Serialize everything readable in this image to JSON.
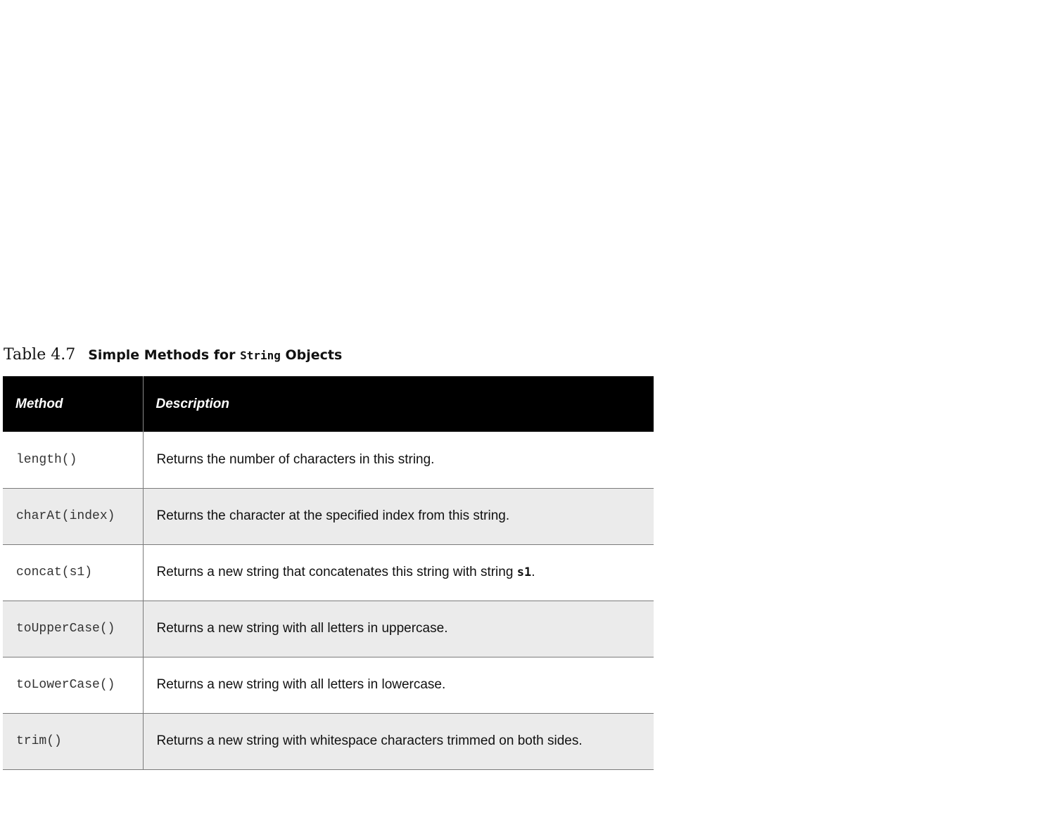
{
  "caption": {
    "number": "Table 4.7",
    "title_before": "Simple Methods for ",
    "title_code": "String",
    "title_after": " Objects"
  },
  "table": {
    "headers": {
      "method": "Method",
      "description": "Description"
    },
    "rows": [
      {
        "method": "length()",
        "description": "Returns the number of characters in this string."
      },
      {
        "method": "charAt(index)",
        "description": "Returns the character at the specified index from this string."
      },
      {
        "method": "concat(s1)",
        "description_before": "Returns a new string that concatenates this string with string ",
        "description_code": "s1",
        "description_after": "."
      },
      {
        "method": "toUpperCase()",
        "description": "Returns a new string with all letters in uppercase."
      },
      {
        "method": "toLowerCase()",
        "description": "Returns a new string with all letters in lowercase."
      },
      {
        "method": "trim()",
        "description": "Returns a new string with whitespace characters trimmed on both sides."
      }
    ]
  },
  "colors": {
    "header_background": "#000000",
    "header_text": "#ffffff",
    "alternate_row_background": "#ebebeb",
    "row_background": "#ffffff",
    "border": "#7a7a7a"
  }
}
